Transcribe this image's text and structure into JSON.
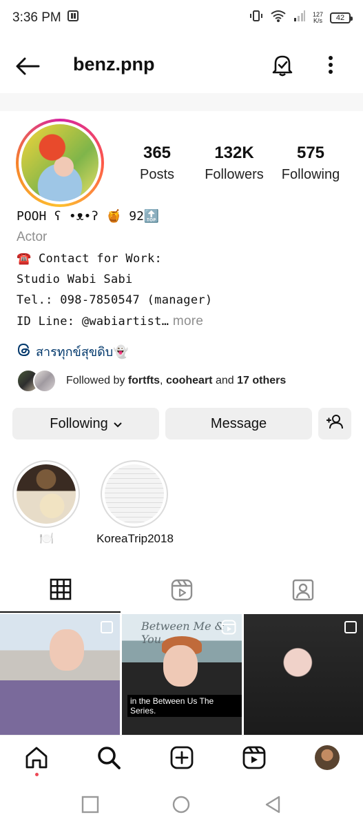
{
  "status_bar": {
    "time": "3:36 PM",
    "net_speed_top": "127",
    "net_speed_bottom": "K/s",
    "battery": "42"
  },
  "header": {
    "username": "benz.pnp"
  },
  "profile": {
    "stats": [
      {
        "value": "365",
        "label": "Posts"
      },
      {
        "value": "132K",
        "label": "Followers"
      },
      {
        "value": "575",
        "label": "Following"
      }
    ],
    "bio": {
      "name": "POOH ʕ •ᴥ•ʔ 🍯 92🔝",
      "category": "Actor",
      "lines": [
        "☎️ Contact for Work:",
        "Studio Wabi Sabi",
        "Tel.: 098-7850547 (manager)",
        "ID Line: @wabiartist…"
      ],
      "more": " more"
    },
    "thread_text": "สารทุกข์สุขดิบ👻",
    "followed_by": {
      "prefix": "Followed by ",
      "user1": "fortfts",
      "sep": ", ",
      "user2": "cooheart",
      "and": " and ",
      "others": "17 others"
    }
  },
  "actions": {
    "following_label": "Following",
    "message_label": "Message"
  },
  "highlights": [
    {
      "caption": "🍽️"
    },
    {
      "caption": "KoreaTrip2018"
    }
  ],
  "grid": {
    "post2_title": "Between Me & You",
    "post2_subtitle": "in the Between Us The Series."
  },
  "colors": {
    "link": "#00376b",
    "button_bg": "#efefef",
    "notification_dot": "#ed4956"
  }
}
